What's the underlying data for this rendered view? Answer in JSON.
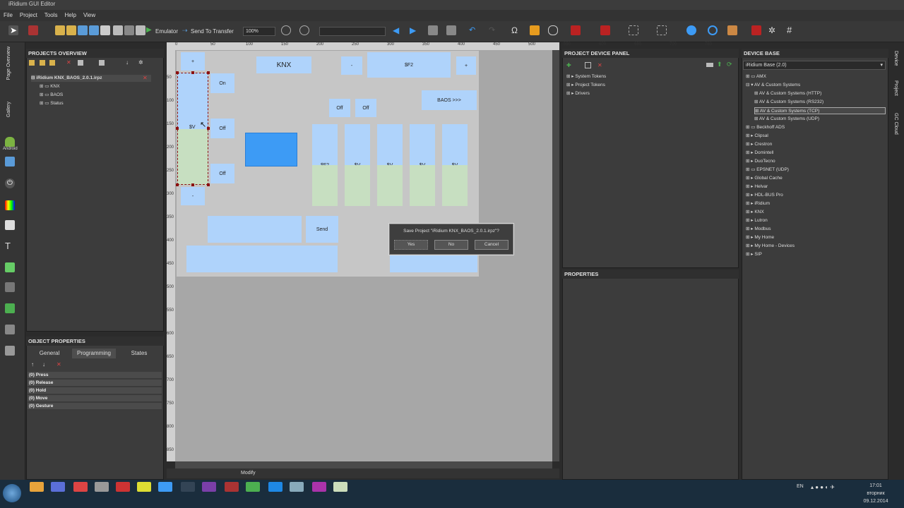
{
  "app": {
    "title": "iRidium GUI Editor"
  },
  "menu": [
    "File",
    "Project",
    "Tools",
    "Help",
    "View"
  ],
  "toolbar": {
    "emulator": "Emulator",
    "send": "Send To Transfer",
    "zoom": "100%"
  },
  "left_tabs": [
    "Page Overview",
    "Gallery",
    "Android"
  ],
  "projects": {
    "header": "PROJECTS OVERVIEW",
    "items": [
      "iRidium KNX_BAOS_2.0.1.irpz",
      "KNX",
      "BAOS",
      "Status"
    ]
  },
  "objprops": {
    "header": "OBJECT PROPERTIES",
    "tabs": [
      "General",
      "Programming",
      "States"
    ],
    "events": [
      "(0) Press",
      "(0) Release",
      "(0) Hold",
      "(0) Move",
      "(0) Gesture"
    ]
  },
  "ruler": {
    "top": [
      "0",
      "50",
      "100",
      "150",
      "200",
      "250",
      "300",
      "350",
      "400",
      "450",
      "500",
      "550",
      "600",
      "650",
      "700",
      "750"
    ],
    "left": [
      "50",
      "100",
      "150",
      "200",
      "250",
      "300",
      "350",
      "400",
      "450",
      "500",
      "550",
      "600",
      "650",
      "700",
      "750",
      "800",
      "850"
    ]
  },
  "canvas": {
    "knx": "KNX",
    "minus_top": "-",
    "f2": "$F2",
    "plus_top": "+",
    "plus_left": "+",
    "on": "On",
    "off1": "Off",
    "off2": "Off",
    "off3": "Off",
    "off4": "Off",
    "baos": "BAOS >>>",
    "v_sel": "$V",
    "minus_left": "-",
    "send": "Send",
    "bars": [
      "$F2",
      "$V",
      "$V",
      "$V",
      "$V"
    ]
  },
  "dialog": {
    "title": "Save Project \"iRidium KNX_BAOS_2.0.1.irpz\"?",
    "yes": "Yes",
    "no": "No",
    "cancel": "Cancel"
  },
  "status": {
    "mode": "Modify"
  },
  "device_panel": {
    "header": "PROJECT DEVICE PANEL",
    "items": [
      "System Tokens",
      "Project Tokens",
      "Drivers"
    ]
  },
  "properties": {
    "header": "PROPERTIES"
  },
  "device_base": {
    "header": "DEVICE BASE",
    "selector": "iRidium Base (2.0)",
    "items": [
      "AMX",
      "AV & Custom Systems",
      "AV & Custom Systems (HTTP)",
      "AV & Custom Systems (RS232)",
      "AV & Custom Systems (TCP)",
      "AV & Custom Systems (UDP)",
      "Beckhoff ADS",
      "Clipsal",
      "Crestron",
      "Domintell",
      "DuoTecno",
      "EPSNET (UDP)",
      "Global Cache",
      "Helvar",
      "HDL-BUS Pro",
      "iRidium",
      "KNX",
      "Lutron",
      "Modbus",
      "My Home",
      "My Home - Devices",
      "SIP"
    ]
  },
  "right_tabs": [
    "Device",
    "Project",
    "GC Cloud"
  ],
  "tray": {
    "lang": "EN",
    "time": "17:01",
    "day": "вторник",
    "date": "09.12.2014"
  },
  "colors": {
    "widget": "#afd3fb",
    "green": "#c7dfc1",
    "canvas": "#a7a7a7",
    "page": "#c6c6c6",
    "accent": "#3d9bf5",
    "selection": "#d8d8d8"
  }
}
